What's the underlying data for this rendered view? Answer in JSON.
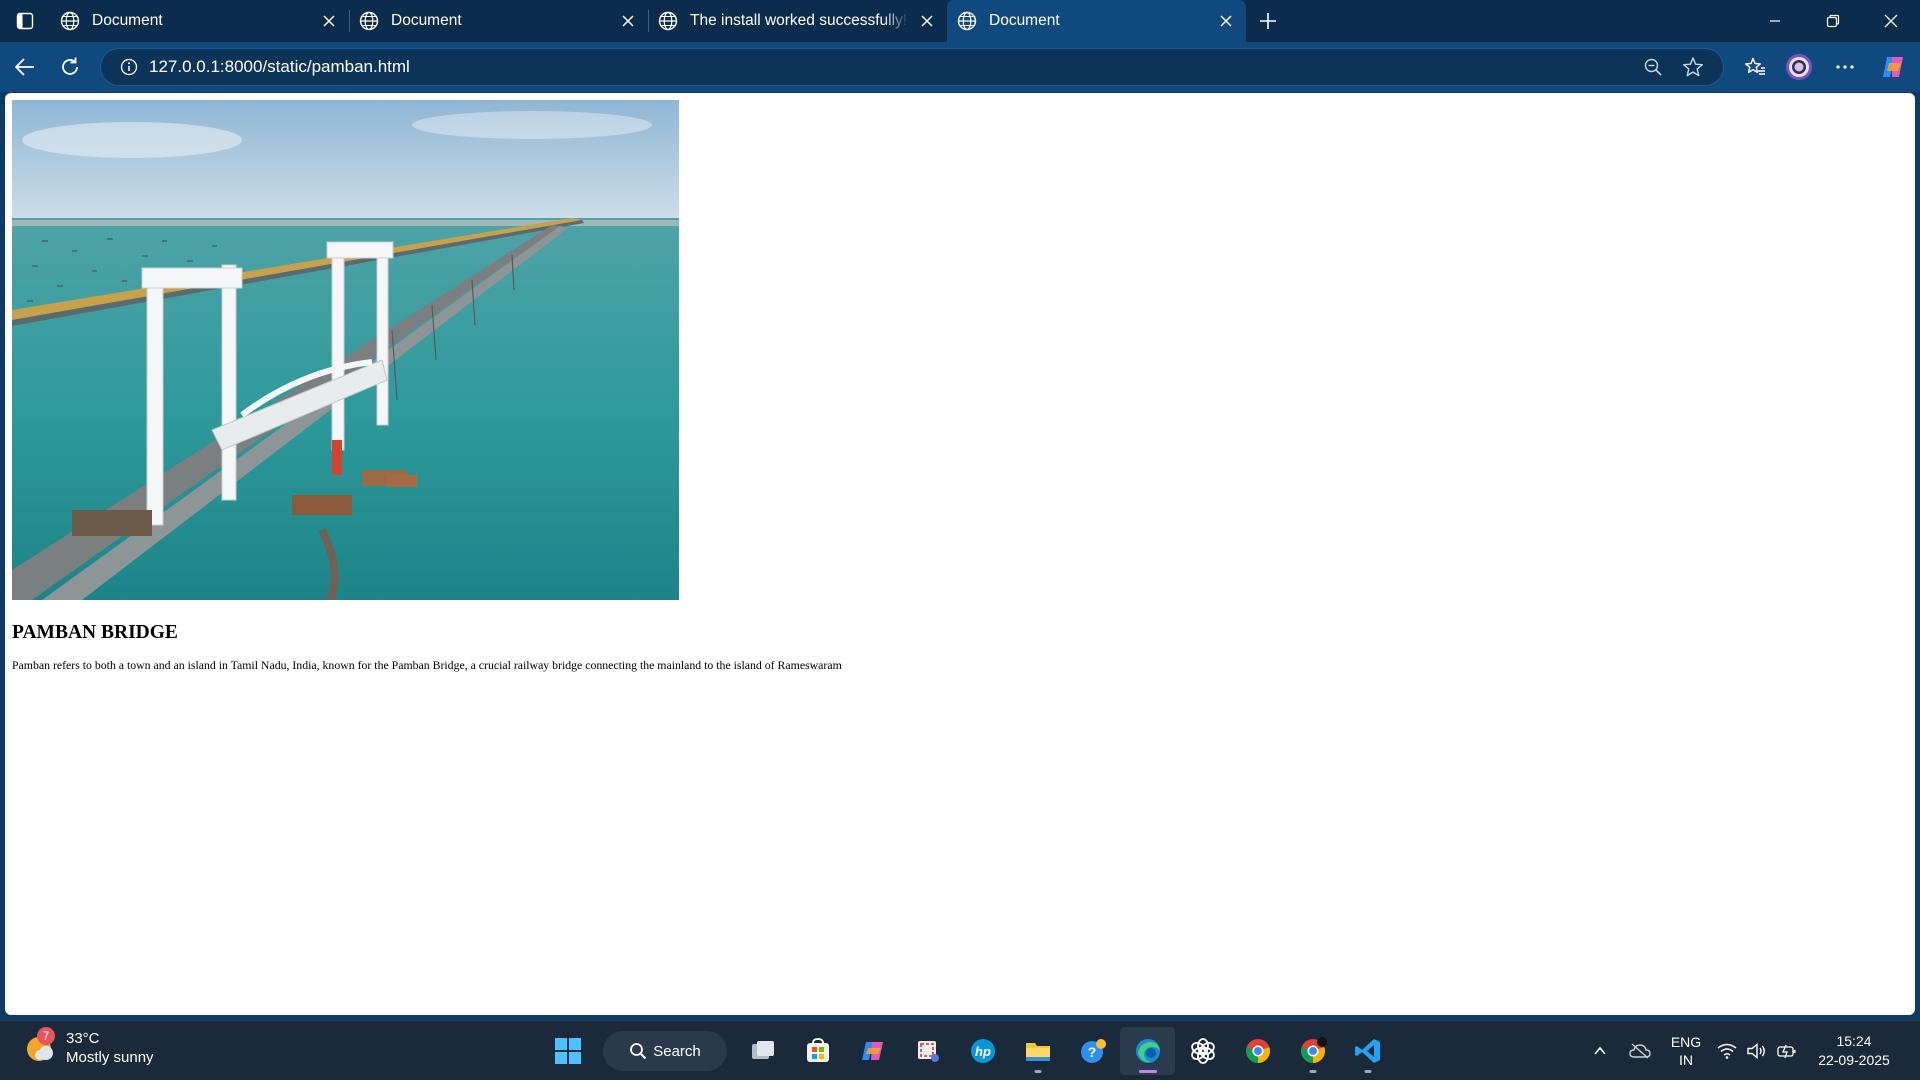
{
  "browser": {
    "tabs": [
      {
        "title": "Document",
        "active": false
      },
      {
        "title": "Document",
        "active": false
      },
      {
        "title": "The install worked successfully! Congratulations!",
        "active": false
      },
      {
        "title": "Document",
        "active": true
      }
    ],
    "address_url": "127.0.0.1:8000/static/pamban.html"
  },
  "page": {
    "image_alt": "Pamban bridge aerial view",
    "heading": "PAMBAN BRIDGE",
    "paragraph": "Pamban refers to both a town and an island in Tamil Nadu, India, known for the Pamban Bridge, a crucial railway bridge connecting the mainland to the island of Rameswaram"
  },
  "taskbar": {
    "weather_badge": "7",
    "temperature": "33°C",
    "condition": "Mostly sunny",
    "search_label": "Search",
    "language_line1": "ENG",
    "language_line2": "IN",
    "time": "15:24",
    "date": "22-09-2025"
  }
}
